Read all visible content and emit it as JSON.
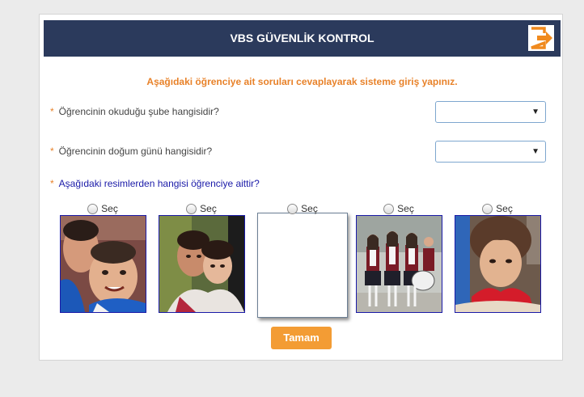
{
  "header": {
    "title": "VBS GÜVENLİK KONTROL",
    "exit_icon": "exit-arrow-icon"
  },
  "instruction": "Aşağıdaki öğrenciye ait soruları cevaplayarak sisteme giriş yapınız.",
  "questions": [
    {
      "label": "Öğrencinin okuduğu şube hangisidir?",
      "required_mark": "*",
      "selected_value": ""
    },
    {
      "label": "Öğrencinin doğum günü hangisidir?",
      "required_mark": "*",
      "selected_value": ""
    },
    {
      "label": "Aşağıdaki resimlerden hangisi öğrenciye aittir?",
      "required_mark": "*"
    }
  ],
  "choices": [
    {
      "label": "Seç",
      "image": "photo-two-boys"
    },
    {
      "label": "Seç",
      "image": "photo-two-girls"
    },
    {
      "label": "Seç",
      "image": "photo-blank"
    },
    {
      "label": "Seç",
      "image": "photo-girls-with-drum"
    },
    {
      "label": "Seç",
      "image": "photo-girl-red-scarf"
    }
  ],
  "submit_label": "Tamam",
  "colors": {
    "header_bg": "#2b3a5c",
    "accent": "#e8822a",
    "button": "#f39c34",
    "link_blue": "#1a1aa8"
  }
}
